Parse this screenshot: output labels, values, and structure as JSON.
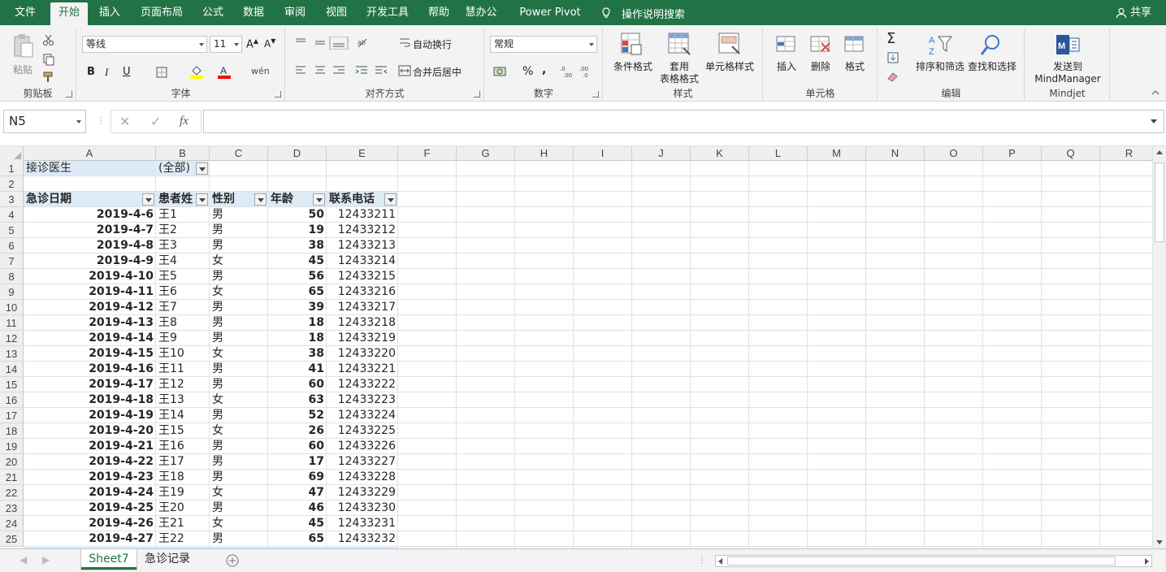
{
  "menu": {
    "tabs": [
      "文件",
      "开始",
      "插入",
      "页面布局",
      "公式",
      "数据",
      "审阅",
      "视图",
      "开发工具",
      "帮助",
      "慧办公",
      "Power Pivot"
    ],
    "active_tab": "开始",
    "tell_me": "操作说明搜索",
    "share": "共享"
  },
  "ribbon": {
    "clipboard": {
      "label": "剪贴板",
      "paste": "粘贴"
    },
    "font": {
      "label": "字体",
      "name": "等线",
      "size": "11",
      "bold": "B",
      "italic": "I",
      "underline": "U",
      "font_color": "#ff0000",
      "fill_color": "#ffff00"
    },
    "alignment": {
      "label": "对齐方式",
      "wrap": "自动换行",
      "merge": "合并后居中"
    },
    "number": {
      "label": "数字",
      "format": "常规",
      "percent": "%",
      "comma": ","
    },
    "styles": {
      "label": "样式",
      "conditional": "条件格式",
      "table1": "套用",
      "table2": "表格格式",
      "cell_styles": "单元格样式"
    },
    "cells": {
      "label": "单元格",
      "insert": "插入",
      "delete": "删除",
      "format": "格式"
    },
    "editing": {
      "label": "编辑",
      "sort": "排序和筛选",
      "find": "查找和选择"
    },
    "mindjet": {
      "label": "Mindjet",
      "send1": "发送到",
      "send2": "MindManager"
    }
  },
  "formula_bar": {
    "name_box": "N5",
    "fx": "fx",
    "content": ""
  },
  "columns": [
    "A",
    "B",
    "C",
    "D",
    "E",
    "F",
    "G",
    "H",
    "I",
    "J",
    "K",
    "L",
    "M",
    "N",
    "O",
    "P",
    "Q",
    "R"
  ],
  "rows": [
    "1",
    "2",
    "3",
    "4",
    "5",
    "6",
    "7",
    "8",
    "9",
    "10",
    "11",
    "12",
    "13",
    "14",
    "15",
    "16",
    "17",
    "18",
    "19",
    "20",
    "21",
    "22",
    "23",
    "24",
    "25"
  ],
  "pivot": {
    "filter_label": "接诊医生",
    "filter_value": "(全部)",
    "headers": [
      "急诊日期",
      "患者姓",
      "性别",
      "年龄",
      "联系电话"
    ],
    "records": [
      [
        "2019-4-6",
        "王1",
        "男",
        "50",
        "12433211"
      ],
      [
        "2019-4-7",
        "王2",
        "男",
        "19",
        "12433212"
      ],
      [
        "2019-4-8",
        "王3",
        "男",
        "38",
        "12433213"
      ],
      [
        "2019-4-9",
        "王4",
        "女",
        "45",
        "12433214"
      ],
      [
        "2019-4-10",
        "王5",
        "男",
        "56",
        "12433215"
      ],
      [
        "2019-4-11",
        "王6",
        "女",
        "65",
        "12433216"
      ],
      [
        "2019-4-12",
        "王7",
        "男",
        "39",
        "12433217"
      ],
      [
        "2019-4-13",
        "王8",
        "男",
        "18",
        "12433218"
      ],
      [
        "2019-4-14",
        "王9",
        "男",
        "18",
        "12433219"
      ],
      [
        "2019-4-15",
        "王10",
        "女",
        "38",
        "12433220"
      ],
      [
        "2019-4-16",
        "王11",
        "男",
        "41",
        "12433221"
      ],
      [
        "2019-4-17",
        "王12",
        "男",
        "60",
        "12433222"
      ],
      [
        "2019-4-18",
        "王13",
        "女",
        "63",
        "12433223"
      ],
      [
        "2019-4-19",
        "王14",
        "男",
        "52",
        "12433224"
      ],
      [
        "2019-4-20",
        "王15",
        "女",
        "26",
        "12433225"
      ],
      [
        "2019-4-21",
        "王16",
        "男",
        "60",
        "12433226"
      ],
      [
        "2019-4-22",
        "王17",
        "男",
        "17",
        "12433227"
      ],
      [
        "2019-4-23",
        "王18",
        "男",
        "69",
        "12433228"
      ],
      [
        "2019-4-24",
        "王19",
        "女",
        "47",
        "12433229"
      ],
      [
        "2019-4-25",
        "王20",
        "男",
        "46",
        "12433230"
      ],
      [
        "2019-4-26",
        "王21",
        "女",
        "45",
        "12433231"
      ],
      [
        "2019-4-27",
        "王22",
        "男",
        "65",
        "12433232"
      ]
    ]
  },
  "sheets": [
    "Sheet7",
    "急诊记录"
  ],
  "active_sheet": "Sheet7",
  "colors": {
    "brand": "#217346",
    "pivot_header": "#ddebf7"
  }
}
